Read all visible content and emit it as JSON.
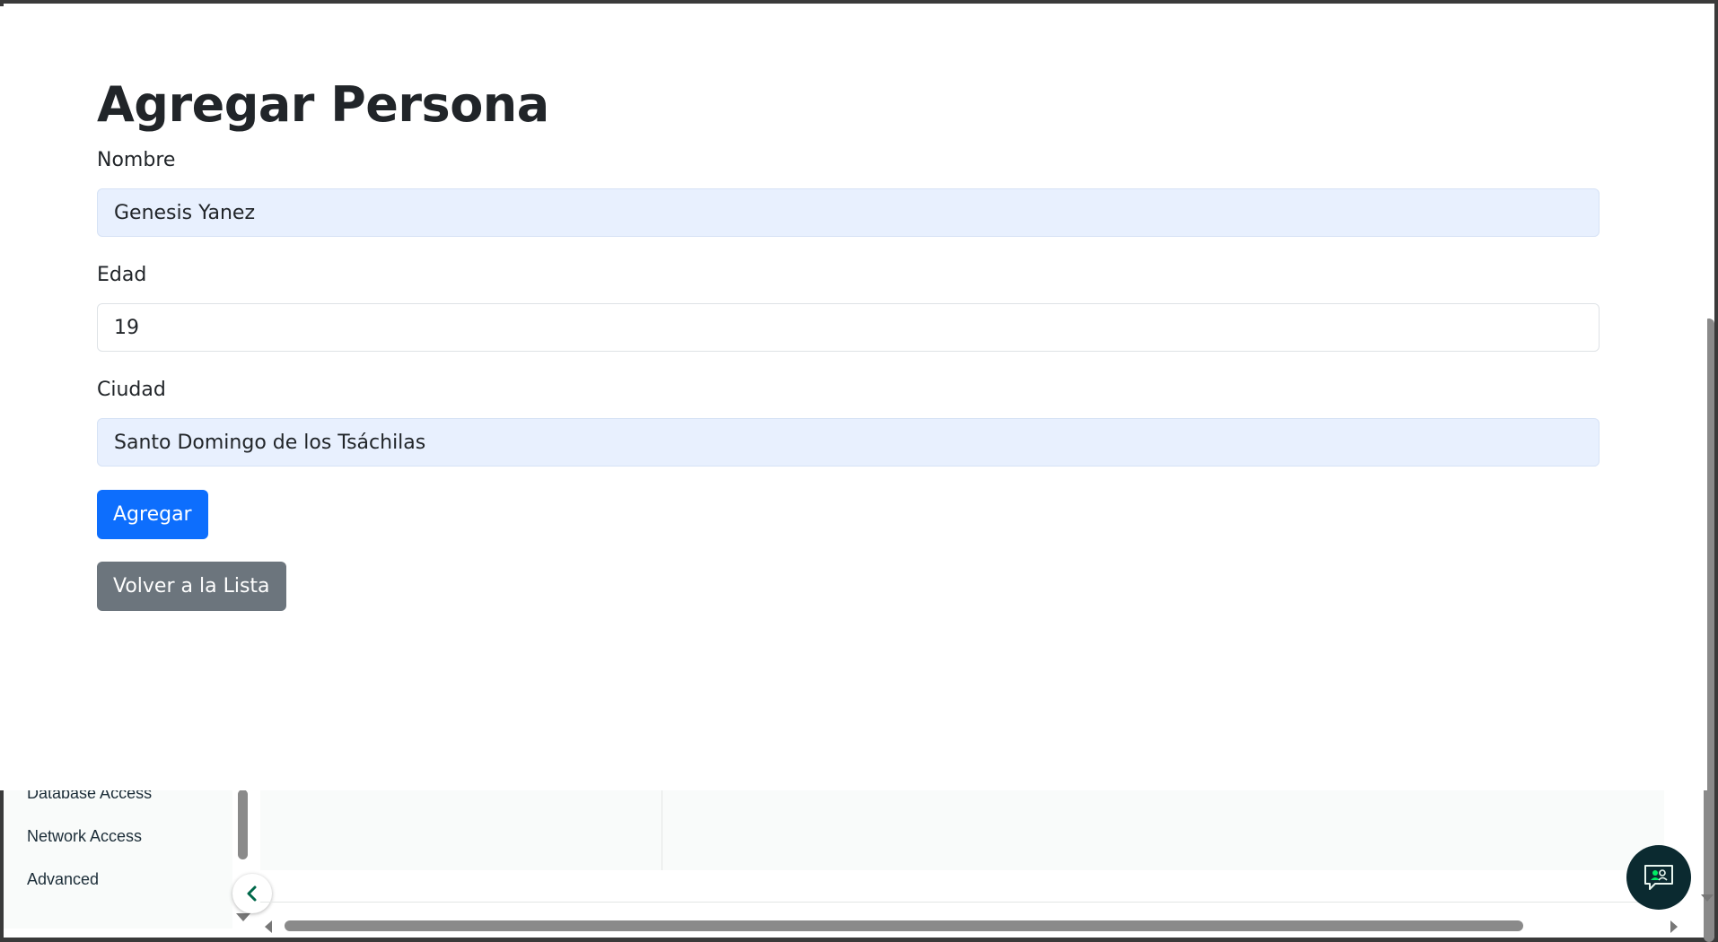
{
  "form": {
    "title": "Agregar Persona",
    "fields": [
      {
        "label": "Nombre",
        "value": "Genesis Yanez",
        "autofilled": true
      },
      {
        "label": "Edad",
        "value": "19",
        "autofilled": false
      },
      {
        "label": "Ciudad",
        "value": "Santo Domingo de los Tsáchilas",
        "autofilled": true
      }
    ],
    "submit_label": "Agregar",
    "back_label": "Volver a la Lista"
  },
  "background": {
    "sidebar_items": [
      "Database Access",
      "Network Access",
      "Advanced"
    ]
  },
  "icons": {
    "collapse": "chevron-left-icon",
    "chat": "chat-support-icon"
  },
  "colors": {
    "primary_button": "#0d6efd",
    "secondary_button": "#6c757d",
    "autofill_background": "#e8f0fe",
    "accent_green": "#00684a",
    "chat_button": "#0b2a30"
  }
}
